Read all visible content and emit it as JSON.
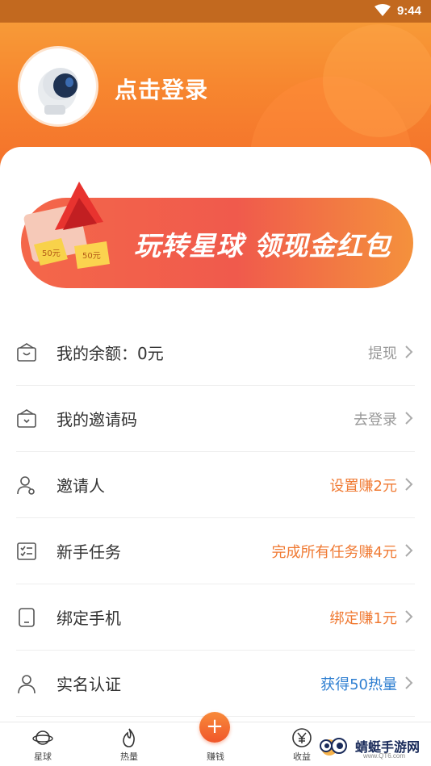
{
  "status_bar": {
    "time": "9:44",
    "wifi_icon": "wifi-icon"
  },
  "profile": {
    "login_label": "点击登录",
    "avatar_icon": "astronaut-avatar"
  },
  "banner": {
    "title": "玩转星球 领现金红包",
    "envelope_labels": [
      "50元",
      "50元"
    ]
  },
  "menu": [
    {
      "label": "我的余额：0元",
      "action": "提现",
      "action_color": "#999999",
      "icon": "wallet-icon"
    },
    {
      "label": "我的邀请码",
      "action": "去登录",
      "action_color": "#999999",
      "icon": "envelope-icon"
    },
    {
      "label": "邀请人",
      "action": "设置赚2元",
      "action_color": "#f07a33",
      "icon": "user-add-icon"
    },
    {
      "label": "新手任务",
      "action": "完成所有任务赚4元",
      "action_color": "#f07a33",
      "icon": "checklist-icon"
    },
    {
      "label": "绑定手机",
      "action": "绑定赚1元",
      "action_color": "#f07a33",
      "icon": "phone-icon"
    },
    {
      "label": "实名认证",
      "action": "获得50热量",
      "action_color": "#2f7fd1",
      "icon": "person-icon"
    }
  ],
  "tabbar": [
    {
      "label": "星球",
      "icon": "planet-icon"
    },
    {
      "label": "热量",
      "icon": "flame-icon"
    },
    {
      "label": "赚钱",
      "icon": "plus-icon"
    },
    {
      "label": "收益",
      "icon": "yen-icon"
    }
  ],
  "plus_symbol": "+",
  "watermark": {
    "main": "蜻蜓手游网",
    "sub": "www.QT6.com"
  }
}
